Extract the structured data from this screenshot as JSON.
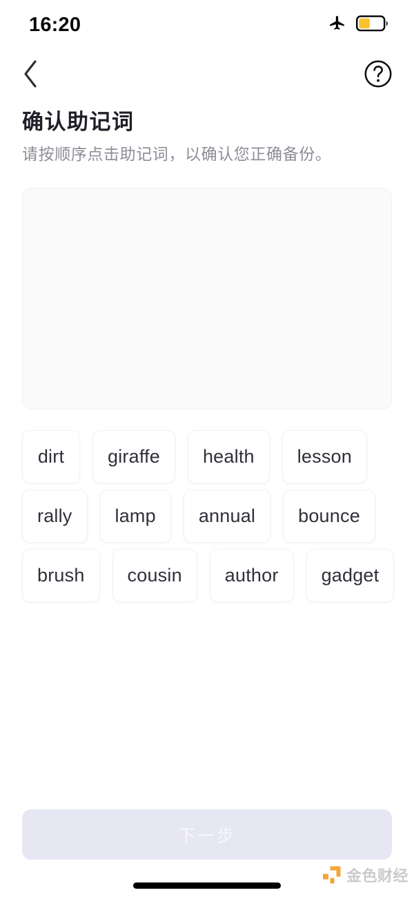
{
  "status_bar": {
    "time": "16:20",
    "airplane_icon": "airplane-mode-icon",
    "battery_icon": "battery-low-power-icon",
    "battery_level_percent": 40,
    "battery_color": "#fbc02d"
  },
  "nav_bar": {
    "back_icon": "chevron-left-icon",
    "help_icon": "question-mark-circle-icon"
  },
  "heading": {
    "title": "确认助记词",
    "subtitle": "请按顺序点击助记词，以确认您正确备份。"
  },
  "selection_card": {
    "selected_words": [],
    "background_color": "#fafafb",
    "border_color": "#f1f1f3"
  },
  "word_bank": {
    "words": [
      "dirt",
      "giraffe",
      "health",
      "lesson",
      "rally",
      "lamp",
      "annual",
      "bounce",
      "brush",
      "cousin",
      "author",
      "gadget"
    ]
  },
  "footer": {
    "next_label": "下一步",
    "next_enabled": false,
    "next_background_color": "#e7e7f4",
    "next_text_color": "#f6f6fb"
  },
  "watermark": {
    "text": "金色财经",
    "logo_color": "#f0a028"
  }
}
